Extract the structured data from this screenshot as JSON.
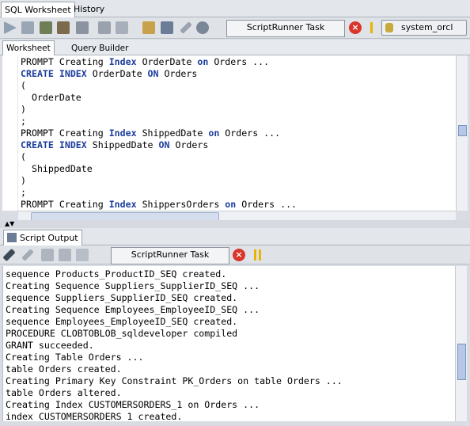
{
  "top_tabs": [
    "SQL Worksheet",
    "History"
  ],
  "toolbar": {
    "task_label": "ScriptRunner Task",
    "connection": "system_orcl"
  },
  "sub_tabs": [
    "Worksheet",
    "Query Builder"
  ],
  "editor_lines": [
    [
      [
        "PROMPT Creating ",
        ""
      ],
      [
        "Index",
        "kw"
      ],
      [
        " OrderDate ",
        ""
      ],
      [
        "on",
        "kw"
      ],
      [
        " Orders ...",
        ""
      ]
    ],
    [
      [
        "CREATE INDEX",
        "kw"
      ],
      [
        " OrderDate ",
        ""
      ],
      [
        "ON",
        "kw"
      ],
      [
        " Orders",
        ""
      ]
    ],
    [
      [
        "(",
        ""
      ]
    ],
    [
      [
        "  OrderDate",
        ""
      ]
    ],
    [
      [
        ")",
        ""
      ]
    ],
    [
      [
        ";",
        ""
      ]
    ],
    [
      [
        "PROMPT Creating ",
        ""
      ],
      [
        "Index",
        "kw"
      ],
      [
        " ShippedDate ",
        ""
      ],
      [
        "on",
        "kw"
      ],
      [
        " Orders ...",
        ""
      ]
    ],
    [
      [
        "CREATE INDEX",
        "kw"
      ],
      [
        " ShippedDate ",
        ""
      ],
      [
        "ON",
        "kw"
      ],
      [
        " Orders",
        ""
      ]
    ],
    [
      [
        "(",
        ""
      ]
    ],
    [
      [
        "  ShippedDate",
        ""
      ]
    ],
    [
      [
        ")",
        ""
      ]
    ],
    [
      [
        ";",
        ""
      ]
    ],
    [
      [
        "PROMPT Creating ",
        ""
      ],
      [
        "Index",
        "kw"
      ],
      [
        " ShippersOrders ",
        ""
      ],
      [
        "on",
        "kw"
      ],
      [
        " Orders ...",
        ""
      ]
    ]
  ],
  "output_tab": "Script Output",
  "output_toolbar": {
    "task_label": "ScriptRunner Task"
  },
  "output_lines": [
    "sequence Products_ProductID_SEQ created.",
    "Creating Sequence Suppliers_SupplierID_SEQ ...",
    "sequence Suppliers_SupplierID_SEQ created.",
    "Creating Sequence Employees_EmployeeID_SEQ ...",
    "sequence Employees_EmployeeID_SEQ created.",
    "PROCEDURE CLOBTOBLOB_sqldeveloper compiled",
    "GRANT succeeded.",
    "Creating Table Orders ...",
    "table Orders created.",
    "Creating Primary Key Constraint PK_Orders on table Orders ...",
    "table Orders altered.",
    "Creating Index CUSTOMERSORDERS_1 on Orders ...",
    "index CUSTOMERSORDERS_1 created."
  ],
  "colors": {
    "keyword": "#1c3d9c",
    "stop": "#d9352b",
    "pause": "#e8b400"
  }
}
